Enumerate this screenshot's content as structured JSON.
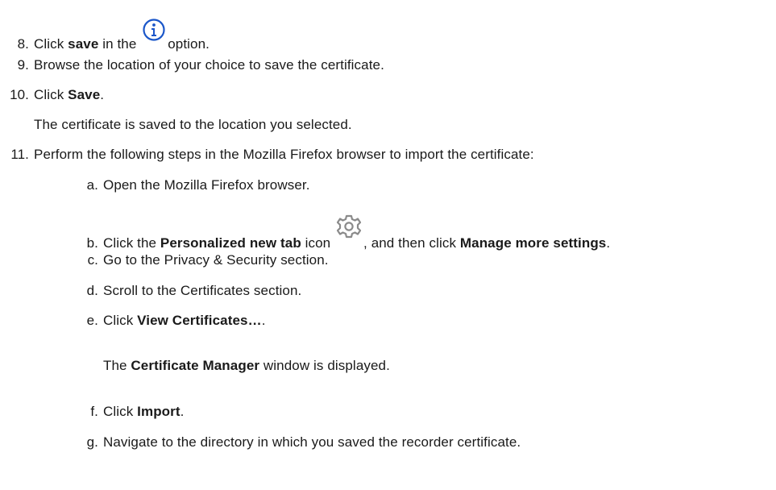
{
  "steps": [
    {
      "num": "8.",
      "pre": "Click ",
      "bold": "save",
      "post": " in the ",
      "icon": "info-circle-icon",
      "tail": "option."
    },
    {
      "num": "9.",
      "text": "Browse the location of your choice to save the certificate."
    },
    {
      "num": "10.",
      "pre": "Click ",
      "bold": "Save",
      "post": "."
    },
    {
      "note": "The certificate is saved to the location you selected."
    },
    {
      "num": "11.",
      "text": "Perform the following steps in the Mozilla Firefox browser to import the certificate:"
    }
  ],
  "substeps": {
    "a": {
      "letter": "a.",
      "text": "Open the Mozilla Firefox browser."
    },
    "b": {
      "letter": "b.",
      "pre": "Click the ",
      "bold": "Personalized new tab",
      "mid": " icon ",
      "icon": "gear-icon",
      "post": ", and then click ",
      "bold2": "Manage more settings",
      "end": "."
    },
    "c": {
      "letter": "c.",
      "text": "Go to the Privacy & Security section."
    },
    "d": {
      "letter": "d.",
      "text": "Scroll to the Certificates section."
    },
    "e": {
      "letter": "e.",
      "pre": "Click ",
      "bold": "View Certificates…",
      "post": "."
    },
    "e_note": {
      "pre": "The ",
      "bold": "Certificate Manager",
      "post": " window is displayed."
    },
    "f": {
      "letter": "f.",
      "pre": "Click ",
      "bold": "Import",
      "post": "."
    },
    "g": {
      "letter": "g.",
      "text": "Navigate to the directory in which you saved the recorder certificate."
    }
  },
  "colors": {
    "icon_blue": "#1a56c9",
    "icon_gray": "#8a8a8a",
    "text": "#1a1a1a"
  }
}
